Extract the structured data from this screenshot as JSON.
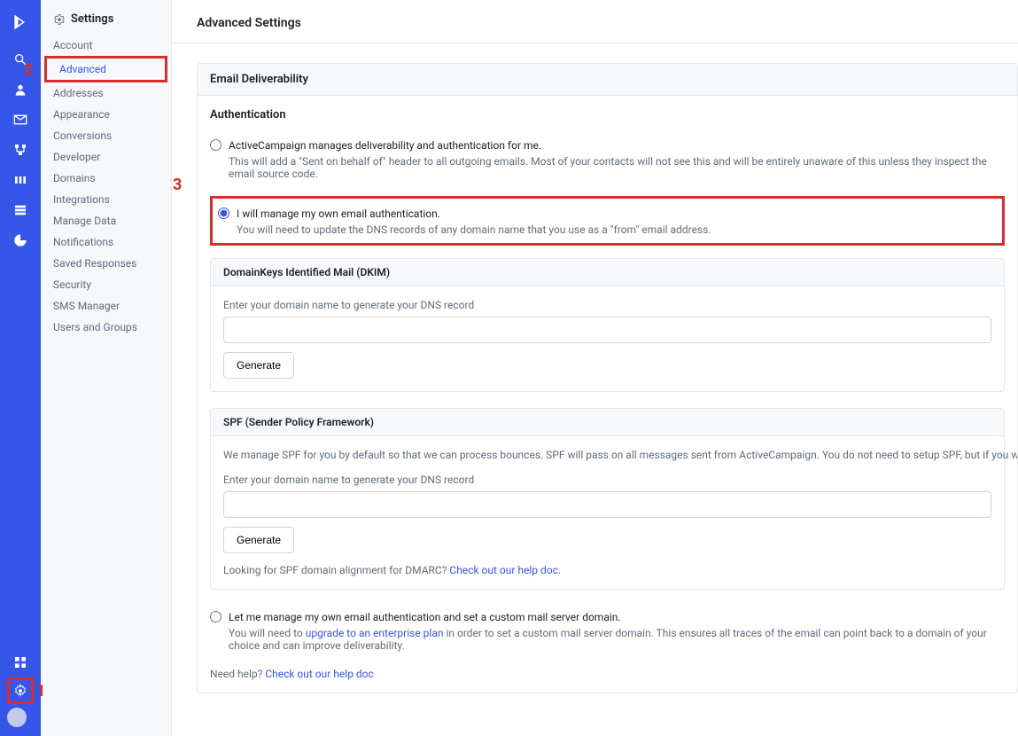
{
  "rail": {
    "items": [
      {
        "name": "logo-icon"
      },
      {
        "name": "search-icon"
      },
      {
        "name": "contacts-icon"
      },
      {
        "name": "campaigns-icon"
      },
      {
        "name": "automations-icon"
      },
      {
        "name": "deals-icon"
      },
      {
        "name": "lists-icon"
      },
      {
        "name": "reports-icon"
      }
    ],
    "bottom": [
      {
        "name": "apps-icon"
      },
      {
        "name": "settings-icon"
      },
      {
        "name": "avatar"
      }
    ]
  },
  "sidebar": {
    "title": "Settings",
    "items": [
      "Account",
      "Advanced",
      "Addresses",
      "Appearance",
      "Conversions",
      "Developer",
      "Domains",
      "Integrations",
      "Manage Data",
      "Notifications",
      "Saved Responses",
      "Security",
      "SMS Manager",
      "Users and Groups"
    ],
    "active_index": 1
  },
  "page": {
    "title": "Advanced Settings"
  },
  "deliverability": {
    "panel_title": "Email Deliverability",
    "auth_heading": "Authentication",
    "opt1": {
      "title": "ActiveCampaign manages deliverability and authentication for me.",
      "desc": "This will add a \"Sent on behalf of\" header to all outgoing emails. Most of your contacts will not see this and will be entirely unaware of this unless they inspect the email source code."
    },
    "opt2": {
      "title": "I will manage my own email authentication.",
      "desc": "You will need to update the DNS records of any domain name that you use as a \"from\" email address."
    },
    "dkim": {
      "title": "DomainKeys Identified Mail (DKIM)",
      "label": "Enter your domain name to generate your DNS record",
      "button": "Generate"
    },
    "spf": {
      "title": "SPF (Sender Policy Framework)",
      "desc": "We manage SPF for you by default so that we can process bounces. SPF will pass on all messages sent from ActiveCampaign. You do not need to setup SPF, but if you would like to add an SPF record do so here.",
      "label": "Enter your domain name to generate your DNS record",
      "button": "Generate",
      "help_pre": "Looking for SPF domain alignment for DMARC? ",
      "help_link": "Check out our help doc"
    },
    "opt3": {
      "title": "Let me manage my own email authentication and set a custom mail server domain.",
      "desc_pre": "You will need to ",
      "desc_link": "upgrade to an enterprise plan",
      "desc_post": " in order to set a custom mail server domain. This ensures all traces of the email can point back to a domain of your choice and can improve deliverability."
    },
    "footer": {
      "pre": "Need help? ",
      "link": "Check out our help doc"
    }
  },
  "annotations": {
    "a1": "1",
    "a2": "2",
    "a3": "3"
  }
}
